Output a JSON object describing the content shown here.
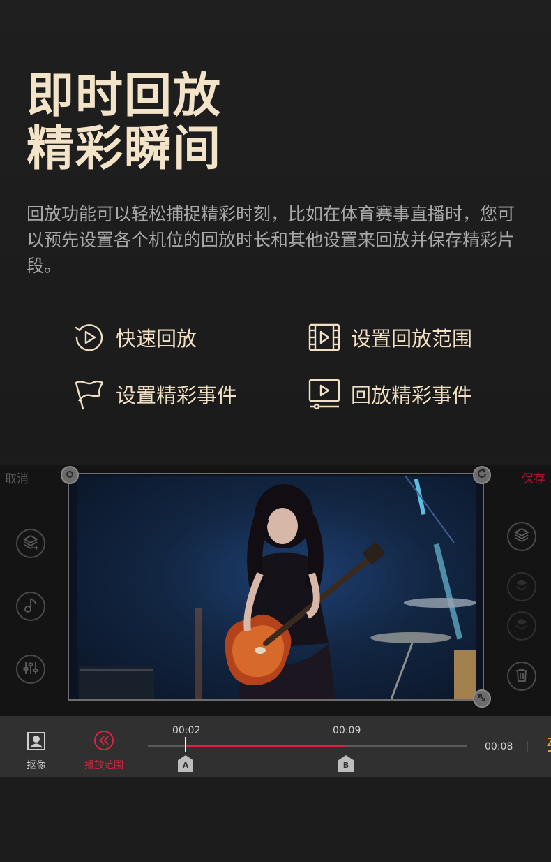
{
  "hero": {
    "title_line1": "即时回放",
    "title_line2": "精彩瞬间",
    "description": "回放功能可以轻松捕捉精彩时刻，比如在体育赛事直播时，您可以预先设置各个机位的回放时长和其他设置来回放并保存精彩片段。"
  },
  "features": [
    {
      "label": "快速回放",
      "icon": "replay-icon"
    },
    {
      "label": "设置回放范围",
      "icon": "film-play-icon"
    },
    {
      "label": "设置精彩事件",
      "icon": "flag-icon"
    },
    {
      "label": "回放精彩事件",
      "icon": "monitor-play-icon"
    }
  ],
  "editor": {
    "cancel_label": "取消",
    "save_label": "保存",
    "left_tools": [
      "add-layer-icon",
      "music-note-icon",
      "mixer-sliders-icon"
    ],
    "right_tools": [
      "layers-icon",
      "layers-add-icon",
      "layers-stack-icon",
      "trash-icon"
    ]
  },
  "toolbar": {
    "portrait_label": "抠像",
    "range_label": "播放范围",
    "time_start": "00:02",
    "time_end": "00:09",
    "duration": "00:08",
    "marker_a": "A",
    "marker_b": "B"
  },
  "colors": {
    "accent_red": "#e0203e",
    "title_gold": "#f3e3c8",
    "background": "#1d1d1d"
  }
}
